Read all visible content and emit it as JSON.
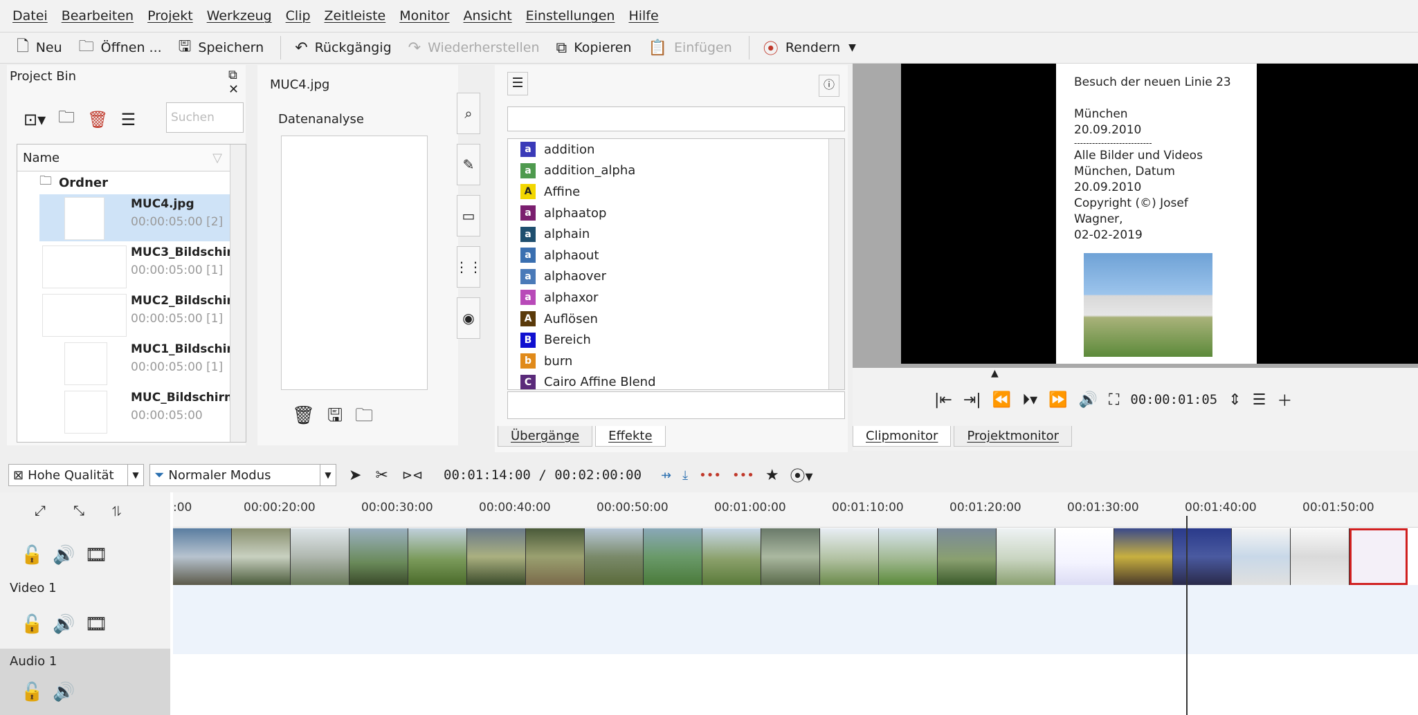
{
  "menu": [
    "Datei",
    "Bearbeiten",
    "Projekt",
    "Werkzeug",
    "Clip",
    "Zeitleiste",
    "Monitor",
    "Ansicht",
    "Einstellungen",
    "Hilfe"
  ],
  "toolbar": {
    "new": "Neu",
    "open": "Öffnen ...",
    "save": "Speichern",
    "undo": "Rückgängig",
    "redo": "Wiederherstellen",
    "copy": "Kopieren",
    "paste": "Einfügen",
    "render": "Rendern"
  },
  "project_bin": {
    "title": "Project Bin",
    "search_placeholder": "Suchen",
    "column_name": "Name",
    "folder": "Ordner",
    "clips": [
      {
        "name": "MUC4.jpg",
        "duration": "00:00:05:00 [2]"
      },
      {
        "name": "MUC3_Bildschir",
        "duration": "00:00:05:00 [1]"
      },
      {
        "name": "MUC2_Bildschir",
        "duration": "00:00:05:00 [1]"
      },
      {
        "name": "MUC1_Bildschir",
        "duration": "00:00:05:00 [1]"
      },
      {
        "name": "MUC_Bildschirn",
        "duration": "00:00:05:00"
      }
    ]
  },
  "clip_properties": {
    "title": "MUC4.jpg",
    "section": "Datenanalyse"
  },
  "effects": {
    "items": [
      {
        "label": "addition",
        "badge": "a",
        "color": "#3a3ab8"
      },
      {
        "label": "addition_alpha",
        "badge": "a",
        "color": "#4e9a4e"
      },
      {
        "label": "Affine",
        "badge": "A",
        "color": "#f2d600"
      },
      {
        "label": "alphaatop",
        "badge": "a",
        "color": "#7b1f6f"
      },
      {
        "label": "alphain",
        "badge": "a",
        "color": "#1f4f6f"
      },
      {
        "label": "alphaout",
        "badge": "a",
        "color": "#3a6fb0"
      },
      {
        "label": "alphaover",
        "badge": "a",
        "color": "#4a7ab8"
      },
      {
        "label": "alphaxor",
        "badge": "a",
        "color": "#b84ab8"
      },
      {
        "label": "Auflösen",
        "badge": "A",
        "color": "#5a3a0a"
      },
      {
        "label": "Bereich",
        "badge": "B",
        "color": "#1010d0"
      },
      {
        "label": "burn",
        "badge": "b",
        "color": "#e08a1a"
      },
      {
        "label": "Cairo Affine Blend",
        "badge": "C",
        "color": "#5a2a7a"
      }
    ],
    "tab_transitions": "Übergänge",
    "tab_effects": "Effekte"
  },
  "monitor": {
    "poster_lines": [
      "Besuch der neuen Linie 23",
      "",
      "München",
      "20.09.2010",
      "--------------------------",
      "Alle Bilder und Videos",
      "München, Datum",
      "20.09.2010",
      "Copyright (©) Josef",
      "Wagner,",
      "02-02-2019"
    ],
    "timecode": "00:00:01:05",
    "tab_clip": "Clipmonitor",
    "tab_project": "Projektmonitor"
  },
  "timeline_toolbar": {
    "quality": "Hohe Qualität",
    "mode": "Normaler Modus",
    "position": "00:01:14:00 / 00:02:00:00"
  },
  "timeline": {
    "ticks": [
      ":00",
      "00:00:20:00",
      "00:00:30:00",
      "00:00:40:00",
      "00:00:50:00",
      "00:01:00:00",
      "00:01:10:00",
      "00:01:20:00",
      "00:01:30:00",
      "00:01:40:00",
      "00:01:50:00"
    ],
    "tracks": [
      "Video 1",
      "Audio 1"
    ]
  }
}
